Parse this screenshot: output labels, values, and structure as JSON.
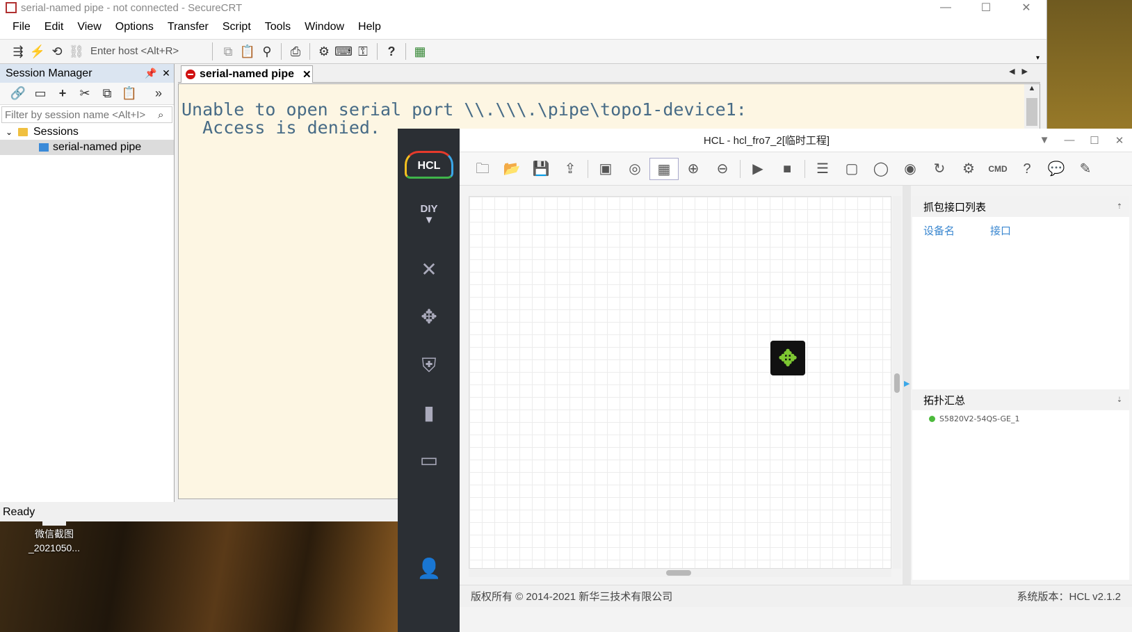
{
  "securecrt": {
    "title": "serial-named pipe - not connected - SecureCRT",
    "window_buttons": [
      "—",
      "☐",
      "✕"
    ],
    "menu": [
      "File",
      "Edit",
      "View",
      "Options",
      "Transfer",
      "Script",
      "Tools",
      "Window",
      "Help"
    ],
    "host_placeholder": "Enter host <Alt+R>",
    "session_manager": {
      "title": "Session Manager",
      "filter_placeholder": "Filter by session name <Alt+I>",
      "root_folder": "Sessions",
      "session_item": "serial-named pipe"
    },
    "tab_label": "serial-named pipe",
    "terminal_text": "Unable to open serial port \\\\.\\\\\\.\\pipe\\topo1-device1:\n  Access is denied.",
    "status": "Ready"
  },
  "desktop": {
    "icon_label_line1": "微信截图",
    "icon_label_line2": "_2021050..."
  },
  "hcl": {
    "title": "HCL - hcl_fro7_2[临时工程]",
    "logo_text": "HCL",
    "sidebar_diy": "DIY",
    "capture_panel": {
      "title": "抓包接口列表",
      "col_device": "设备名",
      "col_interface": "接口"
    },
    "topology_panel": {
      "title": "拓扑汇总",
      "devices": [
        "S5820V2-54QS-GE_1"
      ]
    },
    "copyright": "版权所有 © 2014-2021 新华三技术有限公司",
    "version": "系统版本：HCL v2.1.2",
    "colors": {
      "sidebar": "#2b2f34",
      "accent": "#3a87d0",
      "device_green": "#7ec832",
      "status_dot": "#4cba3c"
    }
  }
}
